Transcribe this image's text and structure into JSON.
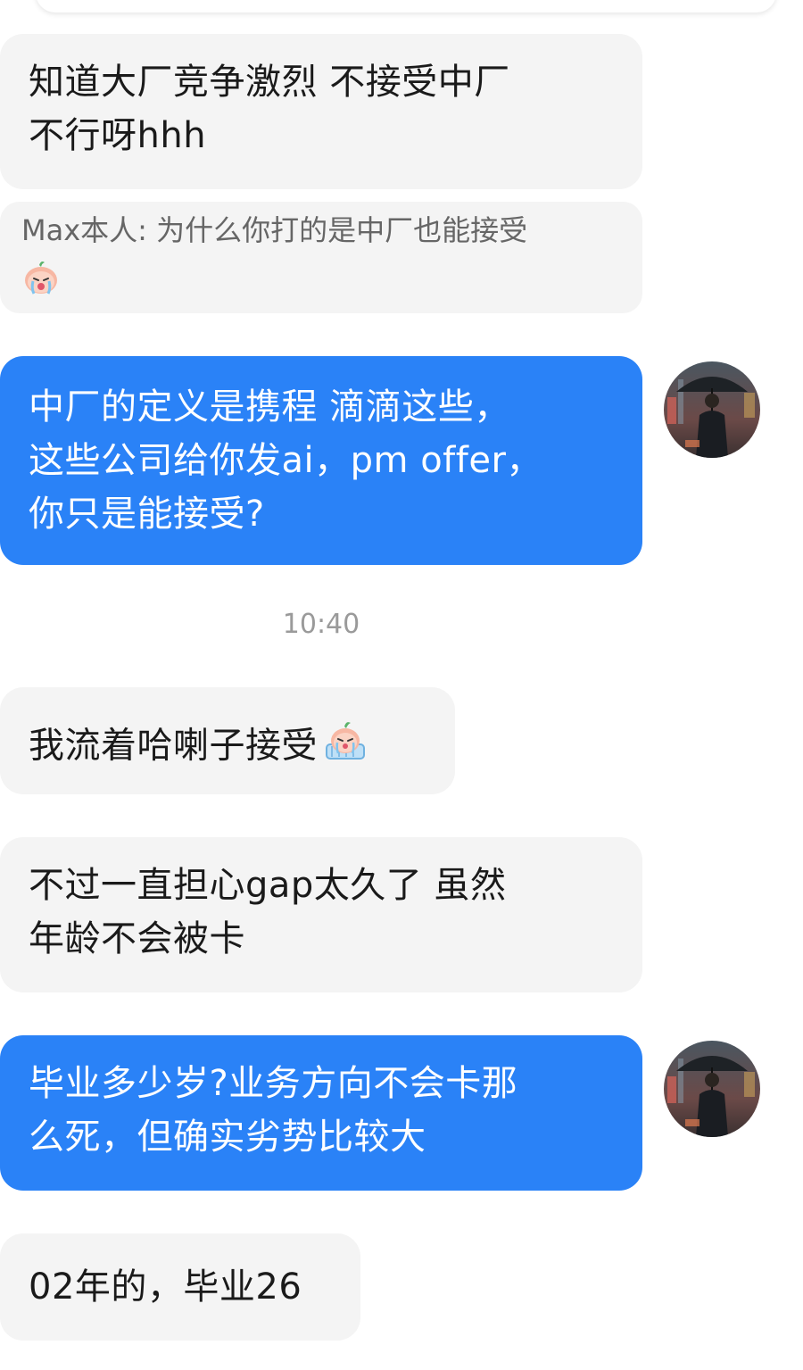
{
  "messages": [
    {
      "side": "in",
      "lines": [
        "知道大厂竞争激烈 不接受中厂",
        "不行呀hhh"
      ]
    },
    {
      "quote_author": "Max本人",
      "quote_sep": ": ",
      "quote_text": "为什么你打的是中厂也能接受",
      "quote_emoji": "crying-peach-emoji"
    },
    {
      "side": "out",
      "lines": [
        "中厂的定义是携程 滴滴这些，",
        "这些公司给你发ai，pm offer，",
        "你只是能接受?"
      ]
    },
    {
      "timestamp": "10:40"
    },
    {
      "side": "in",
      "text": "我流着哈喇子接受",
      "emoji": "drooling-peach-emoji"
    },
    {
      "side": "in",
      "lines": [
        "不过一直担心gap太久了 虽然",
        "年龄不会被卡"
      ]
    },
    {
      "side": "out",
      "lines": [
        "毕业多少岁?业务方向不会卡那",
        "么死，但确实劣势比较大"
      ]
    },
    {
      "side": "in",
      "text": "02年的，毕业26"
    }
  ],
  "avatar": {
    "description_name": "avatar-man-with-umbrella"
  },
  "colors": {
    "outgoing_bubble": "#2a82f7",
    "incoming_bubble": "#f4f4f4",
    "timestamp": "#9a9a9a"
  }
}
